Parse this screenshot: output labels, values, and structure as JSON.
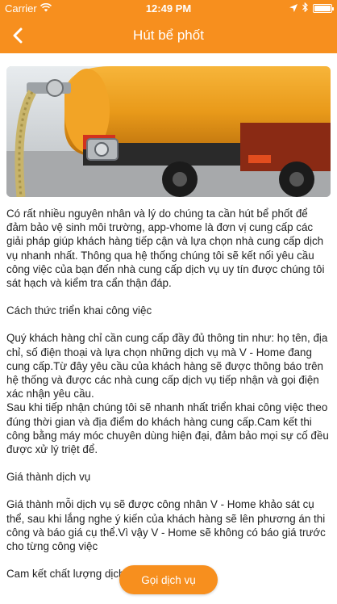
{
  "status_bar": {
    "carrier": "Carrier",
    "time": "12:49 PM"
  },
  "header": {
    "title": "Hút bể phốt"
  },
  "hero": {
    "alt": "vacuum-truck-photo"
  },
  "article": {
    "p1": "Có rất nhiều nguyên nhân và lý do chúng ta cần hút bể phốt để đảm bảo vệ sinh môi trường, app-vhome là đơn vị cung cấp các giải pháp giúp khách hàng tiếp cận và lựa chọn nhà cung cấp dịch vụ nhanh nhất. Thông qua hệ thống chúng tôi sẽ kết nối yêu cầu công việc của bạn đến nhà cung cấp dịch vụ uy tín được chúng tôi sát hạch và kiểm tra cẩn thận đáp.",
    "h1": "Cách thức triển khai công việc",
    "p2": "Quý khách hàng chỉ cần cung cấp đầy đủ thông tin như: họ tên, địa chỉ, số điện thoại và lựa chọn những dịch vụ mà V - Home đang cung cấp.Từ đây yêu cầu của khách hàng sẽ được thông báo trên hệ thống và được các nhà cung cấp dịch vụ tiếp nhận và gọi điện xác nhận yêu cầu.",
    "p3": "Sau khi tiếp nhận chúng tôi sẽ nhanh nhất triển khai công việc theo đúng thời gian và địa điểm do khách hàng cung cấp.Cam kết thi công bằng máy móc chuyên dùng hiện đại, đảm bảo mọi sự cố đều được xử lý triệt để.",
    "h2": "Giá thành dịch vụ",
    "p4": "Giá thành mỗi dịch vụ sẽ được công nhân V - Home khảo sát cụ thể, sau khi lắng nghe ý kiến của khách hàng sẽ lên phương án thi công và báo giá cụ thể.Vì vậy V - Home sẽ không có báo giá trước cho từng công việc",
    "h3": "Cam kết chất lượng dịch vụ"
  },
  "call_button": {
    "label": "Gọi dịch vụ"
  },
  "colors": {
    "accent": "#f78f1e"
  }
}
